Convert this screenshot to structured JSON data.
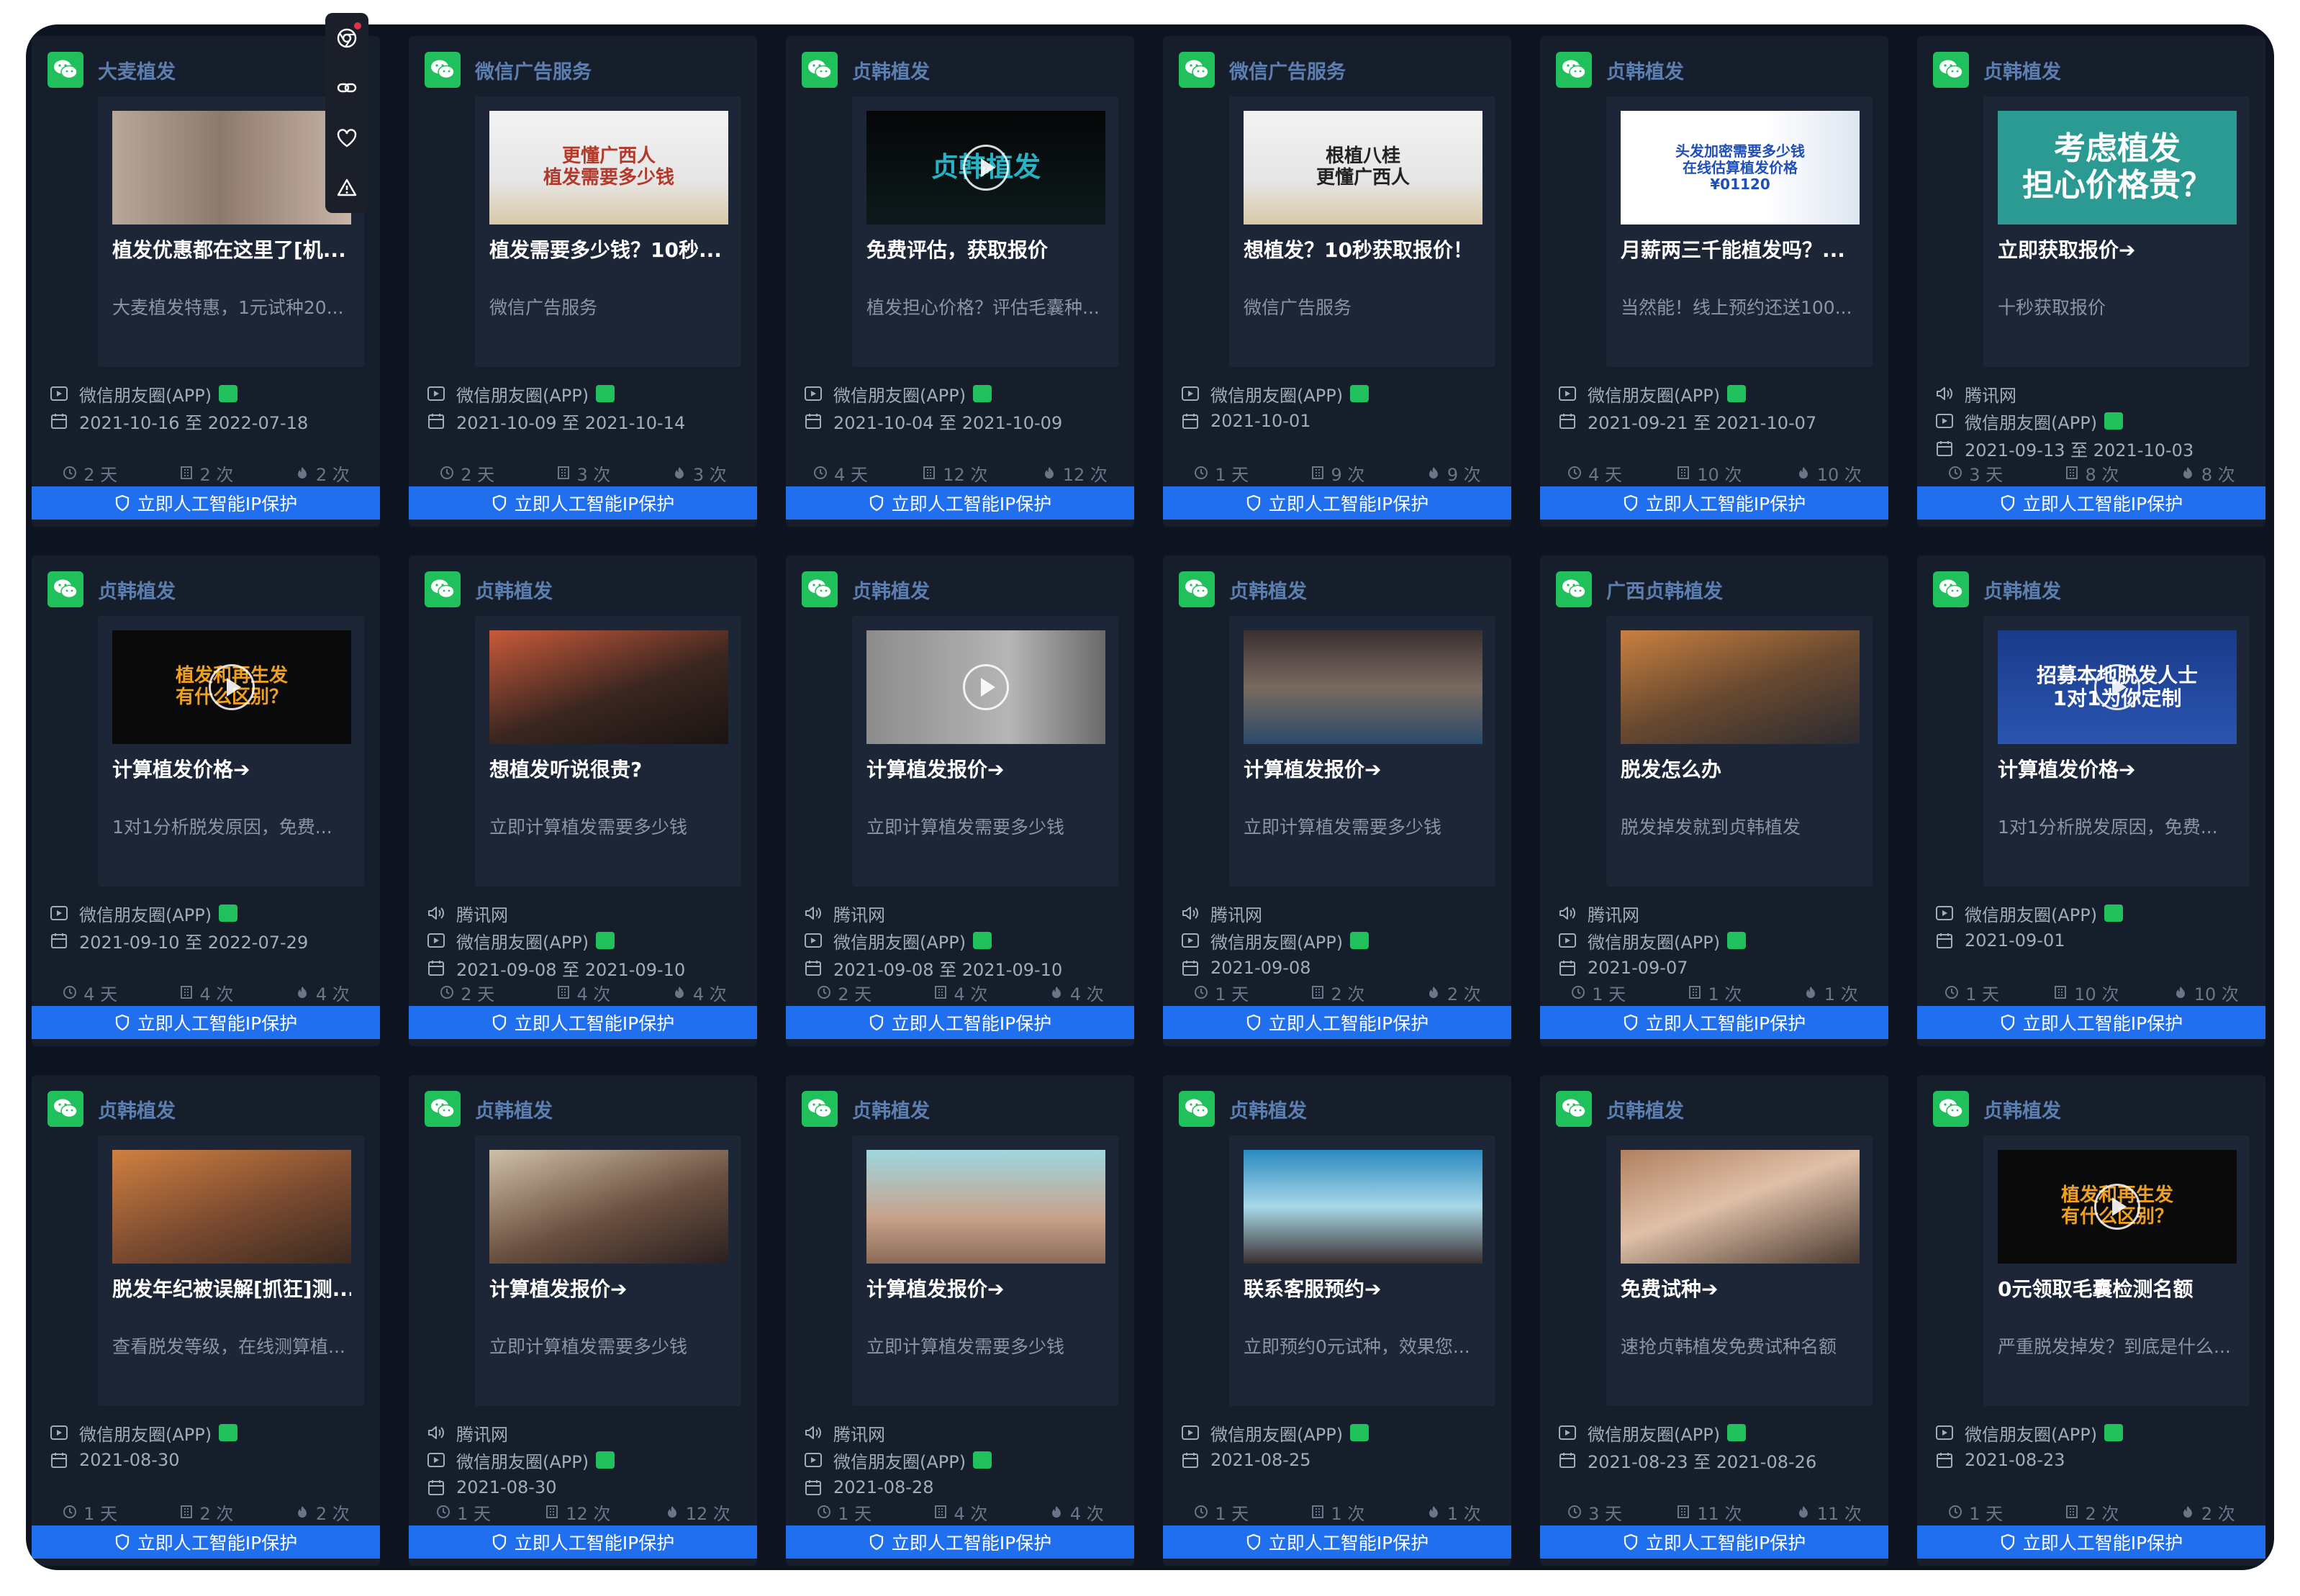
{
  "protect_label": "立即人工智能IP保护",
  "stat_unit_days": "天",
  "stat_unit_times": "次",
  "colors": {
    "frame_bg": "#0d1420",
    "card_bg": "#161e2c",
    "wechat_green": "#20c15d",
    "button_blue": "#1f6fee",
    "advertiser_text": "#5d7fb0"
  },
  "cards": [
    {
      "advertiser": "大麦植发",
      "headline": "植发优惠都在这里了[机...",
      "desc": "大麦植发特惠，1元试种20...",
      "thumb": {
        "text": "",
        "bg": "linear-gradient(90deg,#b9a79b 0%,#8d7a6d 45%,#c8b5a6 100%)",
        "color": "#fff",
        "size": 26,
        "play": false
      },
      "meta": [
        {
          "icon": "video",
          "text": "微信朋友圈(APP)",
          "chip": true
        },
        {
          "icon": "calendar",
          "text": "2021-10-16 至 2022-07-18"
        }
      ],
      "stats": [
        "2 天",
        "2 次",
        "2 次"
      ]
    },
    {
      "advertiser": "微信广告服务",
      "headline": "植发需要多少钱？10秒...",
      "desc": "微信广告服务",
      "thumb": {
        "text": "更懂广西人\n植发需要多少钱",
        "bg": "linear-gradient(180deg,#f2f2f2 0%,#e6e6e6 60%,#d9c9a8 100%)",
        "color": "#b33a2a",
        "size": 26,
        "play": false
      },
      "meta": [
        {
          "icon": "video",
          "text": "微信朋友圈(APP)",
          "chip": true
        },
        {
          "icon": "calendar",
          "text": "2021-10-09 至 2021-10-14"
        }
      ],
      "stats": [
        "2 天",
        "3 次",
        "3 次"
      ]
    },
    {
      "advertiser": "贞韩植发",
      "headline": "免费评估，获取报价",
      "desc": "植发担心价格？评估毛囊种...",
      "thumb": {
        "text": "贞韩植发",
        "bg": "linear-gradient(180deg,#050607 0%,#0d1a1c 100%)",
        "color": "#27b3c4",
        "size": 38,
        "play": true
      },
      "meta": [
        {
          "icon": "video",
          "text": "微信朋友圈(APP)",
          "chip": true
        },
        {
          "icon": "calendar",
          "text": "2021-10-04 至 2021-10-09"
        }
      ],
      "stats": [
        "4 天",
        "12 次",
        "12 次"
      ]
    },
    {
      "advertiser": "微信广告服务",
      "headline": "想植发？10秒获取报价！",
      "desc": "微信广告服务",
      "thumb": {
        "text": "根植八桂\n更懂广西人",
        "bg": "linear-gradient(180deg,#f2f2f2 0%,#e6e6e6 60%,#d9c9a8 100%)",
        "color": "#222",
        "size": 26,
        "play": false
      },
      "meta": [
        {
          "icon": "video",
          "text": "微信朋友圈(APP)",
          "chip": true
        },
        {
          "icon": "calendar",
          "text": "2021-10-01"
        }
      ],
      "stats": [
        "1 天",
        "9 次",
        "9 次"
      ]
    },
    {
      "advertiser": "贞韩植发",
      "headline": "月薪两三千能植发吗？...",
      "desc": "当然能！线上预约还送100...",
      "thumb": {
        "text": "头发加密需要多少钱\n在线估算植发价格\n¥01120",
        "bg": "linear-gradient(90deg,#ffffff 0%,#ffffff 60%,#dfe6f2 100%)",
        "color": "#1f4fb8",
        "size": 20,
        "play": false
      },
      "meta": [
        {
          "icon": "video",
          "text": "微信朋友圈(APP)",
          "chip": true
        },
        {
          "icon": "calendar",
          "text": "2021-09-21 至 2021-10-07"
        }
      ],
      "stats": [
        "4 天",
        "10 次",
        "10 次"
      ]
    },
    {
      "advertiser": "贞韩植发",
      "headline": "立即获取报价➔",
      "desc": "十秒获取报价",
      "thumb": {
        "text": "考虑植发\n担心价格贵？",
        "bg": "#2a9a92",
        "color": "#ffffff",
        "size": 44,
        "play": false
      },
      "meta": [
        {
          "icon": "speaker",
          "text": "腾讯网"
        },
        {
          "icon": "video",
          "text": "微信朋友圈(APP)",
          "chip": true
        },
        {
          "icon": "calendar",
          "text": "2021-09-13 至 2021-10-03"
        }
      ],
      "stats": [
        "3 天",
        "8 次",
        "8 次"
      ]
    },
    {
      "advertiser": "贞韩植发",
      "headline": "计算植发价格➔",
      "desc": "1对1分析脱发原因，免费...",
      "thumb": {
        "text": "植发和再生发\n有什么区别？",
        "bg": "#0a0a0a",
        "color": "#f0a020",
        "size": 26,
        "play": true
      },
      "meta": [
        {
          "icon": "video",
          "text": "微信朋友圈(APP)",
          "chip": true
        },
        {
          "icon": "calendar",
          "text": "2021-09-10 至 2022-07-29"
        }
      ],
      "stats": [
        "4 天",
        "4 次",
        "4 次"
      ]
    },
    {
      "advertiser": "贞韩植发",
      "headline": "想植发听说很贵?",
      "desc": "立即计算植发需要多少钱",
      "thumb": {
        "text": "",
        "bg": "linear-gradient(160deg,#c85a3a 0%,#3a2620 55%,#1a1412 100%)",
        "color": "#fff",
        "size": 26,
        "play": false
      },
      "meta": [
        {
          "icon": "speaker",
          "text": "腾讯网"
        },
        {
          "icon": "video",
          "text": "微信朋友圈(APP)",
          "chip": true
        },
        {
          "icon": "calendar",
          "text": "2021-09-08 至 2021-09-10"
        }
      ],
      "stats": [
        "2 天",
        "4 次",
        "4 次"
      ]
    },
    {
      "advertiser": "贞韩植发",
      "headline": "计算植发报价➔",
      "desc": "立即计算植发需要多少钱",
      "thumb": {
        "text": "",
        "bg": "linear-gradient(90deg,#8c8c8c 0%,#b5b5b5 60%,#6a6a6a 100%)",
        "color": "#fff",
        "size": 26,
        "play": true
      },
      "meta": [
        {
          "icon": "speaker",
          "text": "腾讯网"
        },
        {
          "icon": "video",
          "text": "微信朋友圈(APP)",
          "chip": true
        },
        {
          "icon": "calendar",
          "text": "2021-09-08 至 2021-09-10"
        }
      ],
      "stats": [
        "2 天",
        "4 次",
        "4 次"
      ]
    },
    {
      "advertiser": "贞韩植发",
      "headline": "计算植发报价➔",
      "desc": "立即计算植发需要多少钱",
      "thumb": {
        "text": "",
        "bg": "linear-gradient(180deg,#3a3030 0%,#7a6a60 50%,#2a4a6a 100%)",
        "color": "#fff",
        "size": 26,
        "play": false
      },
      "meta": [
        {
          "icon": "speaker",
          "text": "腾讯网"
        },
        {
          "icon": "video",
          "text": "微信朋友圈(APP)",
          "chip": true
        },
        {
          "icon": "calendar",
          "text": "2021-09-08"
        }
      ],
      "stats": [
        "1 天",
        "2 次",
        "2 次"
      ]
    },
    {
      "advertiser": "广西贞韩植发",
      "headline": "脱发怎么办",
      "desc": "脱发掉发就到贞韩植发",
      "thumb": {
        "text": "",
        "bg": "linear-gradient(160deg,#c98040 0%,#6a4a30 50%,#2a2a30 100%)",
        "color": "#fff",
        "size": 26,
        "play": false
      },
      "meta": [
        {
          "icon": "speaker",
          "text": "腾讯网"
        },
        {
          "icon": "video",
          "text": "微信朋友圈(APP)",
          "chip": true
        },
        {
          "icon": "calendar",
          "text": "2021-09-07"
        }
      ],
      "stats": [
        "1 天",
        "1 次",
        "1 次"
      ]
    },
    {
      "advertiser": "贞韩植发",
      "headline": "计算植发价格➔",
      "desc": "1对1分析脱发原因，免费...",
      "thumb": {
        "text": "招募本地脱发人士\n1对1为你定制",
        "bg": "linear-gradient(180deg,#1a3a8a 0%,#2a55b0 100%)",
        "color": "#ffffff",
        "size": 28,
        "play": true
      },
      "meta": [
        {
          "icon": "video",
          "text": "微信朋友圈(APP)",
          "chip": true
        },
        {
          "icon": "calendar",
          "text": "2021-09-01"
        }
      ],
      "stats": [
        "1 天",
        "10 次",
        "10 次"
      ]
    },
    {
      "advertiser": "贞韩植发",
      "headline": "脱发年纪被误解[抓狂]测...",
      "desc": "查看脱发等级，在线测算植...",
      "thumb": {
        "text": "",
        "bg": "linear-gradient(160deg,#d08040 0%,#7a4a30 55%,#3a2a20 100%)",
        "color": "#fff",
        "size": 26,
        "play": false
      },
      "meta": [
        {
          "icon": "video",
          "text": "微信朋友圈(APP)",
          "chip": true
        },
        {
          "icon": "calendar",
          "text": "2021-08-30"
        }
      ],
      "stats": [
        "1 天",
        "2 次",
        "2 次"
      ]
    },
    {
      "advertiser": "贞韩植发",
      "headline": "计算植发报价➔",
      "desc": "立即计算植发需要多少钱",
      "thumb": {
        "text": "",
        "bg": "linear-gradient(160deg,#d0c0a8 0%,#6a5040 55%,#2a2020 100%)",
        "color": "#fff",
        "size": 26,
        "play": false
      },
      "meta": [
        {
          "icon": "speaker",
          "text": "腾讯网"
        },
        {
          "icon": "video",
          "text": "微信朋友圈(APP)",
          "chip": true
        },
        {
          "icon": "calendar",
          "text": "2021-08-30"
        }
      ],
      "stats": [
        "1 天",
        "12 次",
        "12 次"
      ]
    },
    {
      "advertiser": "贞韩植发",
      "headline": "计算植发报价➔",
      "desc": "立即计算植发需要多少钱",
      "thumb": {
        "text": "",
        "bg": "linear-gradient(180deg,#9fd6e0 0%,#c7a28a 60%,#8a6a58 100%)",
        "color": "#fff",
        "size": 26,
        "play": false
      },
      "meta": [
        {
          "icon": "speaker",
          "text": "腾讯网"
        },
        {
          "icon": "video",
          "text": "微信朋友圈(APP)",
          "chip": true
        },
        {
          "icon": "calendar",
          "text": "2021-08-28"
        }
      ],
      "stats": [
        "1 天",
        "4 次",
        "4 次"
      ]
    },
    {
      "advertiser": "贞韩植发",
      "headline": "联系客服预约➔",
      "desc": "立即预约0元试种，效果您...",
      "thumb": {
        "text": "",
        "bg": "linear-gradient(180deg,#2a8ac0 0%,#a8d8e8 50%,#3a3030 100%)",
        "color": "#fff",
        "size": 26,
        "play": false
      },
      "meta": [
        {
          "icon": "video",
          "text": "微信朋友圈(APP)",
          "chip": true
        },
        {
          "icon": "calendar",
          "text": "2021-08-25"
        }
      ],
      "stats": [
        "1 天",
        "1 次",
        "1 次"
      ]
    },
    {
      "advertiser": "贞韩植发",
      "headline": "免费试种➔",
      "desc": "速抢贞韩植发免费试种名额",
      "thumb": {
        "text": "",
        "bg": "linear-gradient(160deg,#b08060 0%,#e0c0a8 45%,#4a3a30 100%)",
        "color": "#fff",
        "size": 26,
        "play": false
      },
      "meta": [
        {
          "icon": "video",
          "text": "微信朋友圈(APP)",
          "chip": true
        },
        {
          "icon": "calendar",
          "text": "2021-08-23 至 2021-08-26"
        }
      ],
      "stats": [
        "3 天",
        "11 次",
        "11 次"
      ]
    },
    {
      "advertiser": "贞韩植发",
      "headline": "0元领取毛囊检测名额",
      "desc": "严重脱发掉发？到底是什么...",
      "thumb": {
        "text": "植发和再生发\n有什么区别？",
        "bg": "#0a0a0a",
        "color": "#f0a020",
        "size": 26,
        "play": true
      },
      "meta": [
        {
          "icon": "video",
          "text": "微信朋友圈(APP)",
          "chip": true
        },
        {
          "icon": "calendar",
          "text": "2021-08-23"
        }
      ],
      "stats": [
        "1 天",
        "2 次",
        "2 次"
      ]
    }
  ]
}
